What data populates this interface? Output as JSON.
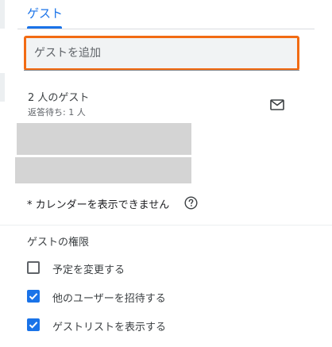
{
  "tab": {
    "label": "ゲスト"
  },
  "guest_input": {
    "placeholder": "ゲストを追加"
  },
  "guests": {
    "count_label": "2 人のゲスト",
    "status_label": "返答待ち: 1 人"
  },
  "calendar_note": "* カレンダーを表示できません",
  "permissions": {
    "title": "ゲストの権限",
    "items": [
      {
        "label": "予定を変更する",
        "checked": false
      },
      {
        "label": "他のユーザーを招待する",
        "checked": true
      },
      {
        "label": "ゲストリストを表示する",
        "checked": true
      }
    ]
  },
  "colors": {
    "accent": "#1a73e8",
    "focus_outline": "#f26b13",
    "redacted": "#d4d4d4"
  },
  "icons": {
    "email": "mail-icon",
    "help": "help-circle-icon",
    "check": "checkmark-icon"
  }
}
